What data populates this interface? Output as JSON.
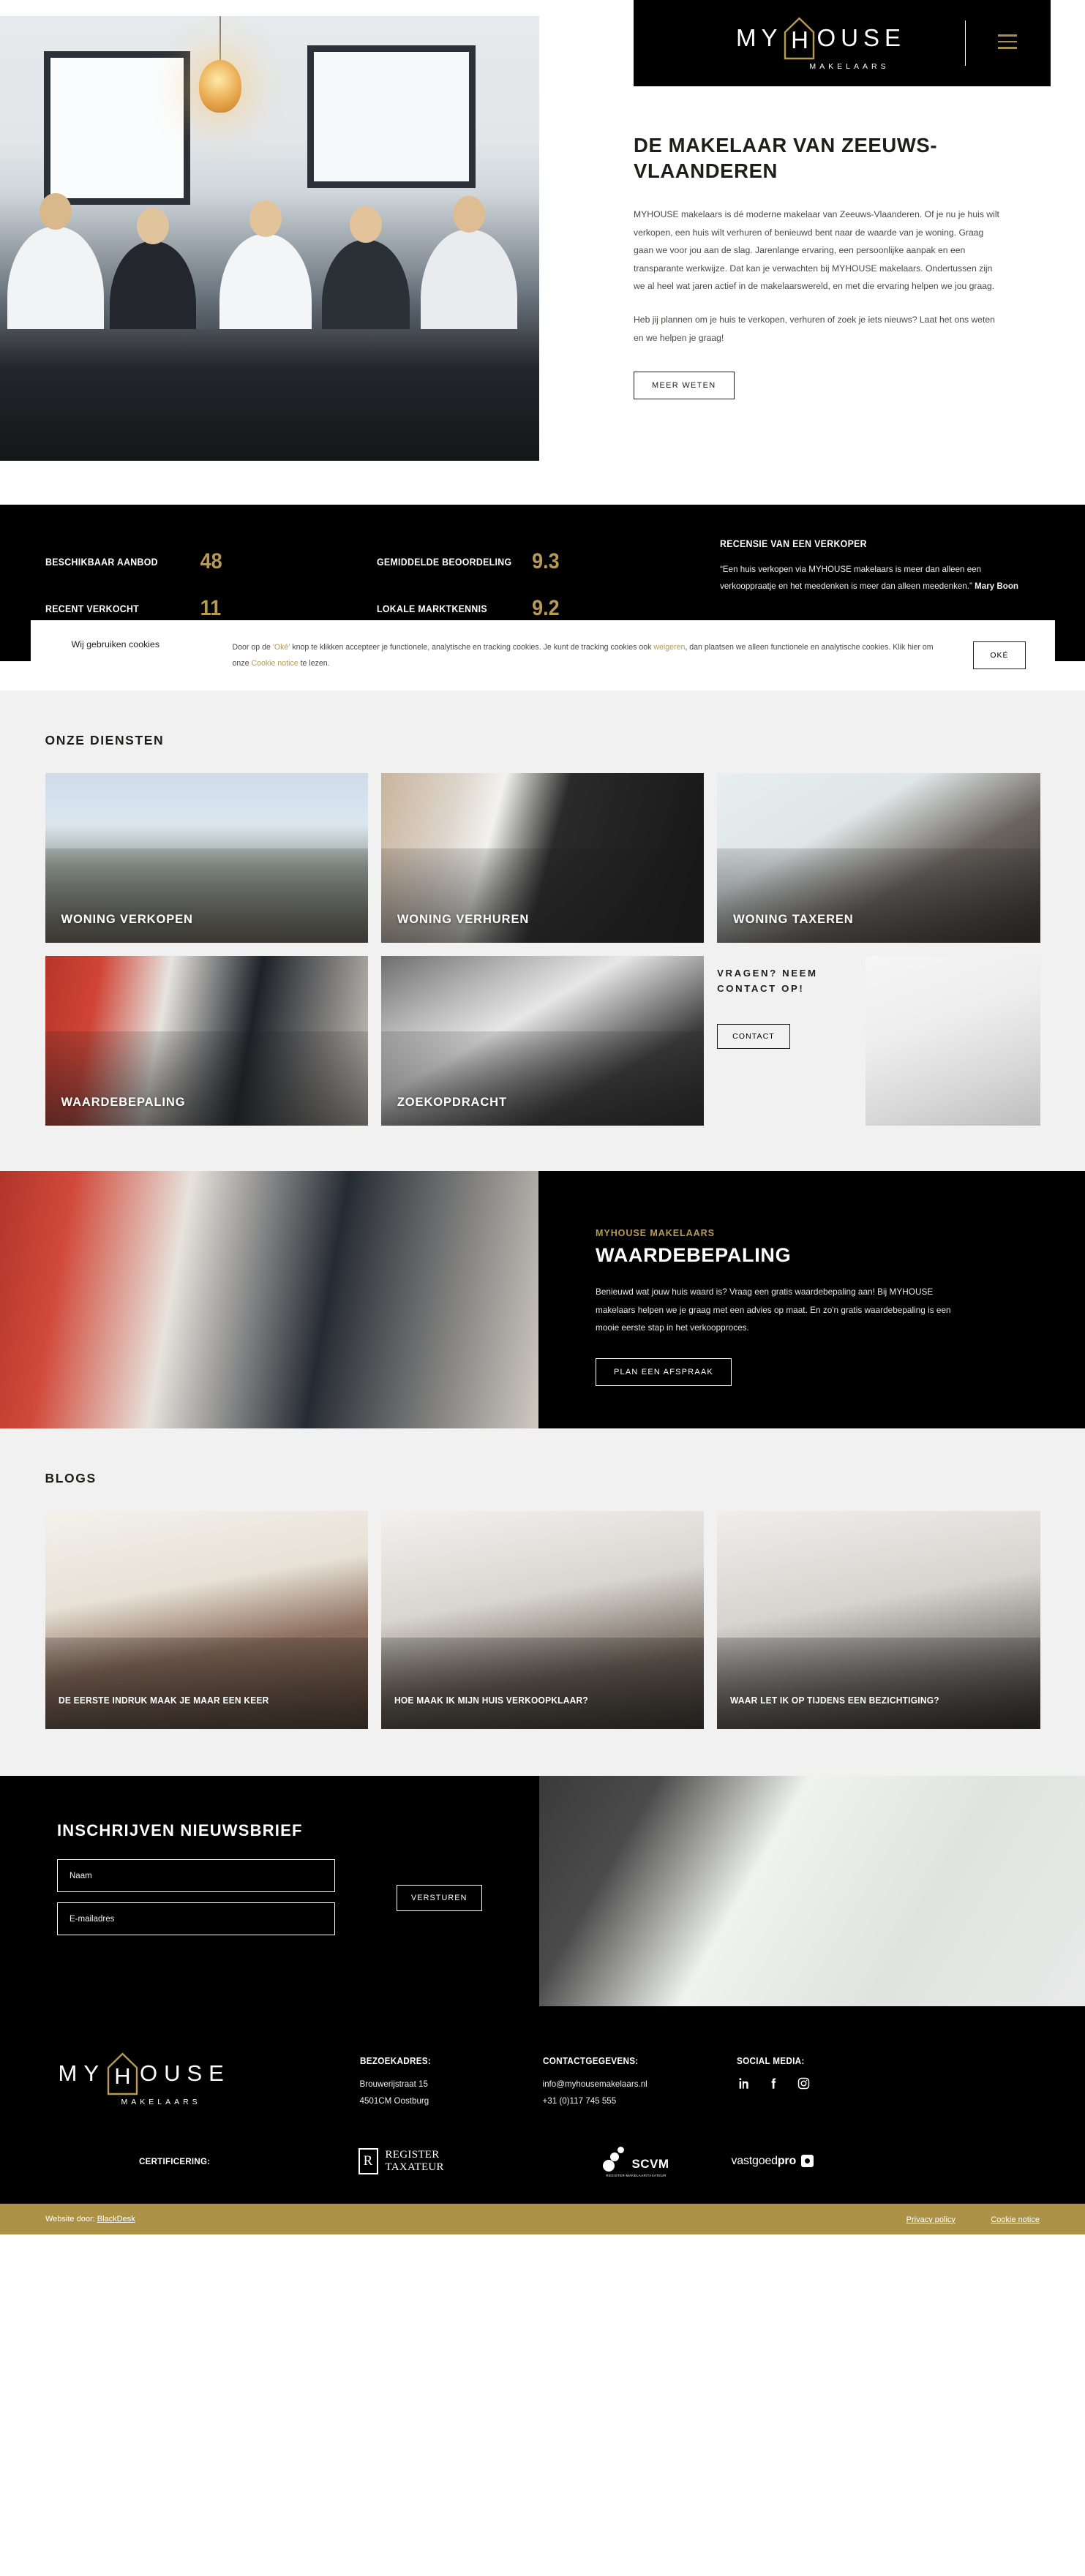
{
  "brand": {
    "name_part1": "MY",
    "name_h": "H",
    "name_part2": "OUSE",
    "subtitle": "MAKELAARS",
    "accent_gold": "#b79b52",
    "bar_gold": "#ab9247",
    "black": "#000000"
  },
  "header": {
    "menu_icon": "hamburger-icon"
  },
  "hero": {
    "title": "DE MAKELAAR VAN ZEEUWS-VLAANDEREN",
    "paragraph1": "MYHOUSE makelaars is dé moderne makelaar van Zeeuws-Vlaanderen. Of je nu je huis wilt verkopen, een huis wilt verhuren of benieuwd bent naar de waarde van je woning. Graag gaan we voor jou aan de slag. Jarenlange ervaring, een persoonlijke aanpak en een transparante werkwijze. Dat kan je verwachten bij MYHOUSE makelaars. Ondertussen zijn we al heel wat jaren actief in de makelaarswereld, en met die ervaring helpen we jou graag.",
    "paragraph2": "Heb jij plannen om je huis te verkopen, verhuren of zoek je iets nieuws? Laat het ons weten en we helpen je graag!",
    "cta": "MEER WETEN"
  },
  "stats": {
    "items": [
      {
        "label": "BESCHIKBAAR AANBOD",
        "value": "48"
      },
      {
        "label": "RECENT VERKOCHT",
        "value": "11"
      },
      {
        "label": "GEMIDDELDE BEOORDELING",
        "value": "9.3"
      },
      {
        "label": "LOKALE MARKTKENNIS",
        "value": "9.2"
      }
    ],
    "review_title": "RECENSIE VAN EEN VERKOPER",
    "review_text": "“Een huis verkopen via MYHOUSE makelaars is meer dan alleen een verkooppraatje en het meedenken is meer dan alleen meedenken.” ",
    "review_author": "Mary Boon"
  },
  "cookie": {
    "title": "Wij gebruiken cookies",
    "text_1": "Door op de ",
    "link_oke": "'Oké'",
    "text_2": " knop te klikken accepteer je functionele, analytische en tracking cookies. Je kunt de tracking cookies ook ",
    "link_weigeren": "weigeren",
    "text_3": ", dan plaatsen we alleen functionele en analytische cookies. Klik hier om onze ",
    "link_notice": "Cookie notice",
    "text_4": " te lezen.",
    "accept_label": "OKÉ"
  },
  "services": {
    "heading": "ONZE DIENSTEN",
    "cards": [
      {
        "label": "WONING VERKOPEN",
        "photo": "street-sign-photo"
      },
      {
        "label": "WONING VERHUREN",
        "photo": "door-keys-photo"
      },
      {
        "label": "WONING TAXEREN",
        "photo": "desk-writing-photo"
      },
      {
        "label": "WAARDEBEPALING",
        "photo": "red-door-photo"
      },
      {
        "label": "ZOEKOPDRACHT",
        "photo": "papers-photo"
      }
    ],
    "contact": {
      "heading": "VRAGEN? NEEM CONTACT OP!",
      "button": "CONTACT",
      "photo": "couple-with-signs-photo"
    }
  },
  "valuation": {
    "kicker": "MYHOUSE MAKELAARS",
    "title": "WAARDEBEPALING",
    "text": "Benieuwd wat jouw huis waard is? Vraag een gratis waardebepaling aan! Bij MYHOUSE makelaars helpen we je graag met een advies op maat. En zo'n gratis waardebepaling is een mooie eerste stap in het verkoopproces.",
    "button": "PLAN EEN AFSPRAAK",
    "photo": "agent-red-door-photo"
  },
  "blogs": {
    "heading": "BLOGS",
    "cards": [
      {
        "title": "DE EERSTE INDRUK MAAK JE MAAR EEN KEER",
        "photo": "living-room-photo"
      },
      {
        "title": "HOE MAAK IK MIJN HUIS VERKOOPKLAAR?",
        "photo": "interior-flowers-photo"
      },
      {
        "title": "WAAR LET IK OP TIJDENS EEN BEZICHTIGING?",
        "photo": "kitchen-photo"
      }
    ]
  },
  "newsletter": {
    "title": "INSCHRIJVEN NIEUWSBRIEF",
    "name_placeholder": "Naam",
    "name_value": "",
    "email_placeholder": "E-mailadres",
    "email_value": "",
    "submit": "VERSTUREN",
    "photo": "phone-typing-photo"
  },
  "footer": {
    "address_heading": "BEZOEKADRES:",
    "address_line1": "Brouwerijstraat 15",
    "address_line2": "4501CM Oostburg",
    "contact_heading": "CONTACTGEGEVENS:",
    "contact_email": "info@myhousemakelaars.nl",
    "contact_phone": "+31 (0)117 745 555",
    "social_heading": "SOCIAL MEDIA:",
    "social": [
      "linkedin-icon",
      "facebook-icon",
      "instagram-icon"
    ],
    "cert_heading": "CERTIFICERING:",
    "cert_register_line1": "REGISTER",
    "cert_register_line2": "TAXATEUR",
    "cert_register_mark": "R",
    "cert_scvm_name": "SCVM",
    "cert_scvm_sub": "REGISTER-MAKELAAR/TAXATEUR",
    "cert_vastgoedpro_1": "vastgoed",
    "cert_vastgoedpro_2": "pro"
  },
  "bottom": {
    "credit_prefix": "Website door: ",
    "credit_name": "BlackDesk",
    "privacy": "Privacy policy",
    "cookie_notice": "Cookie notice"
  }
}
